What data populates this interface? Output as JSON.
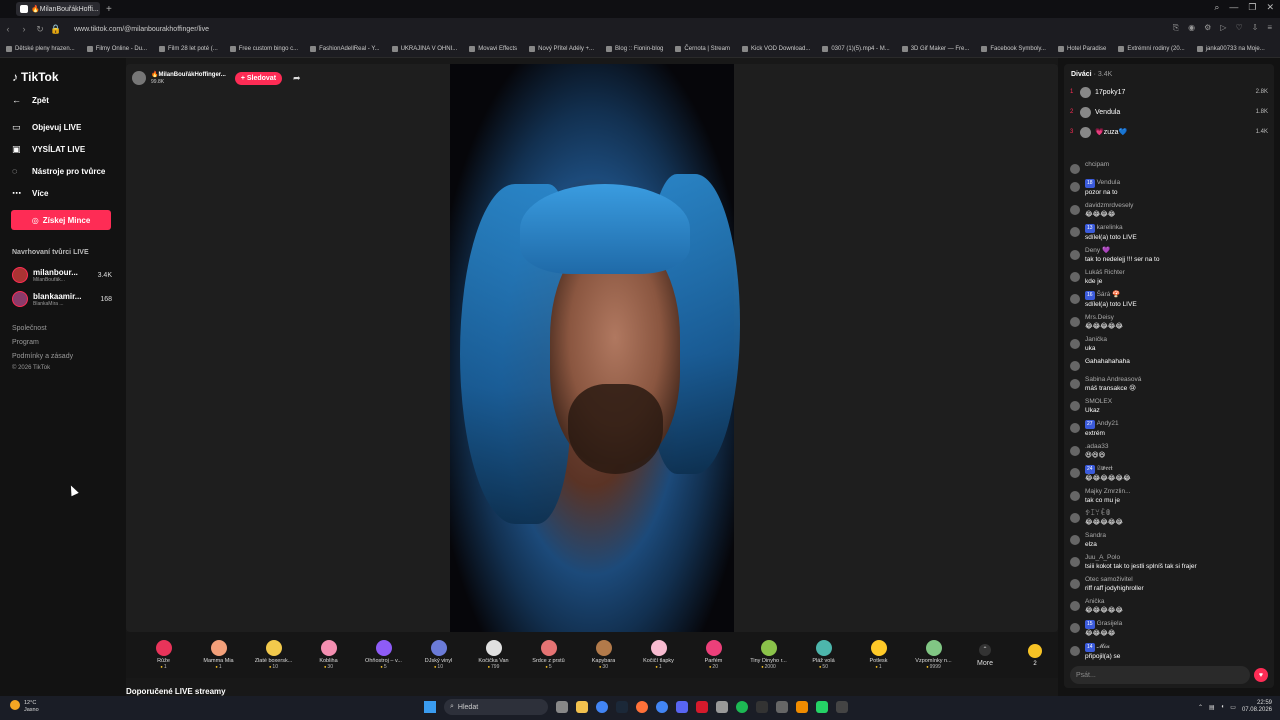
{
  "browser": {
    "tab_title": "🔥MilanBouřákHoffi...",
    "url": "www.tiktok.com/@milanbourakhoffinger/live",
    "bookmarks": [
      "Dětské pleny hrazen...",
      "Filmy Online - Du...",
      "Film 28 let poté (...",
      "Free custom bingo c...",
      "FashionAdellReal - Y...",
      "UKRAJINA V OHNI...",
      "Movavi Effects",
      "Nový Přítel Adély +...",
      "Blog :: Fionin-blog",
      "Černota | Stream",
      "Kick VOD Download...",
      "0307 (1)(5).mp4 - M...",
      "3D Gif Maker — Fre...",
      "Facebook Symboly...",
      "Hotel Paradise",
      "Extrémní rodiny (20...",
      "janka00733 na Moje..."
    ]
  },
  "sidebar": {
    "logo": "TikTok",
    "back": "Zpět",
    "items": [
      {
        "label": "Objevuj LIVE",
        "icon": "tv-icon"
      },
      {
        "label": "VYSÍLAT LIVE",
        "icon": "camera-icon"
      },
      {
        "label": "Nástroje pro tvůrce",
        "icon": "lightbulb-icon"
      },
      {
        "label": "Více",
        "icon": "more-icon"
      }
    ],
    "coins_button": "Získej Mince",
    "suggested_title": "Navrhovaní tvůrci LIVE",
    "creators": [
      {
        "name": "milanbour...",
        "sub": "MilanBouřák...",
        "count": "3.4K"
      },
      {
        "name": "blankaamir...",
        "sub": "BlankaMira ...",
        "count": "168"
      }
    ],
    "footer": [
      "Společnost",
      "Program",
      "Podmínky a zásady",
      "© 2026 TikTok"
    ]
  },
  "host": {
    "name": "🔥MilanBouřákHoffinger...",
    "viewers": "99.8K",
    "follow": "+ Sledovat"
  },
  "gifts": [
    {
      "name": "Růže",
      "price": "1",
      "color": "#e8345a"
    },
    {
      "name": "Mamma Mia",
      "price": "1",
      "color": "#f3a07a"
    },
    {
      "name": "Zlaté boxersk...",
      "price": "10",
      "color": "#f2c94c"
    },
    {
      "name": "Kobliha",
      "price": "30",
      "color": "#f48fb1"
    },
    {
      "name": "Ohňostroj – v...",
      "price": "5",
      "color": "#8e5cf7"
    },
    {
      "name": "DJský vinyl",
      "price": "10",
      "color": "#6b7bd8"
    },
    {
      "name": "Kočička Van",
      "price": "799",
      "color": "#e0e0e0"
    },
    {
      "name": "Srdce z prstů",
      "price": "5",
      "color": "#e57373"
    },
    {
      "name": "Kapybara",
      "price": "30",
      "color": "#b27a4a"
    },
    {
      "name": "Kočičí tlapky",
      "price": "1",
      "color": "#f8bbd0"
    },
    {
      "name": "Parfém",
      "price": "20",
      "color": "#ec407a"
    },
    {
      "name": "Tiny Dinyho r...",
      "price": "2000",
      "color": "#8bc34a"
    },
    {
      "name": "Pláž volá",
      "price": "50",
      "color": "#4db6ac"
    },
    {
      "name": "Potlesk",
      "price": "1",
      "color": "#ffca28"
    },
    {
      "name": "Vzpomínky n...",
      "price": "9999",
      "color": "#81c784"
    }
  ],
  "more_label": "More",
  "coin_count": "2",
  "recommended_title": "Doporučené LIVE streamy",
  "chat": {
    "viewers_title": "Diváci",
    "viewers_count": "· 3.4K",
    "top_viewers": [
      {
        "rank": "1",
        "name": "17poky17",
        "count": "2.8K"
      },
      {
        "rank": "2",
        "name": "Vendula",
        "count": "1.8K"
      },
      {
        "rank": "3",
        "name": "💗zuza💙",
        "count": "1.4K"
      }
    ],
    "messages": [
      {
        "name": "chcipam",
        "text": ""
      },
      {
        "name": "Vendula",
        "text": "pozor na to",
        "level": "18"
      },
      {
        "name": "davidzmrdvesely",
        "text": "😂😂😂😂"
      },
      {
        "name": "karelinka",
        "text": "sdílel(a) toto LIVE",
        "level": "13"
      },
      {
        "name": "Deny 💜",
        "text": "tak to nedelejj !!! ser na to"
      },
      {
        "name": "Lukáš Richter",
        "text": "kde je"
      },
      {
        "name": "Šárá 🍄",
        "text": "sdílel(a) toto LIVE",
        "level": "16"
      },
      {
        "name": "Mrs.Deisy",
        "text": "😂😂😂😂😂"
      },
      {
        "name": "Janička",
        "text": "uka"
      },
      {
        "name": "",
        "text": "Gahahahahaha"
      },
      {
        "name": "Sabina Andreasová",
        "text": "máš transakce 😢"
      },
      {
        "name": "SMOLEX",
        "text": "Ukaz"
      },
      {
        "name": "Andy21",
        "text": "extrém",
        "level": "27"
      },
      {
        "name": ".adaa33",
        "text": "😆😆😆"
      },
      {
        "name": "𝕾𝖜𝖊𝖊𝖙",
        "text": "😂😂😂😂😂😂",
        "level": "24"
      },
      {
        "name": "Majky Zmrzlin...",
        "text": "tak co mu je"
      },
      {
        "name": "ꉣꀤꌩꍟꂦ",
        "text": "😂😂😂😂😂"
      },
      {
        "name": "Sandra",
        "text": "elza"
      },
      {
        "name": "Juu_A_Polo",
        "text": "tsiii kokot tak to jestli splníš tak si frajer"
      },
      {
        "name": "Otec samoživitel",
        "text": "riff raff jodyhighroller"
      },
      {
        "name": "Anička",
        "text": "😂😂😂😂😂"
      },
      {
        "name": "Grasijela",
        "text": "😂😂😂😂",
        "level": "15"
      },
      {
        "name": "𝓜𝓲𝓪",
        "text": "připojil(a) se",
        "level": "14"
      }
    ],
    "input_placeholder": "Psát..."
  },
  "taskbar": {
    "temp": "12°C",
    "weather": "Jasno",
    "search": "Hledat",
    "time": "22:59",
    "date": "07.08.2026"
  },
  "colors": {
    "accent": "#fe2c55",
    "coin": "#f7c325"
  }
}
